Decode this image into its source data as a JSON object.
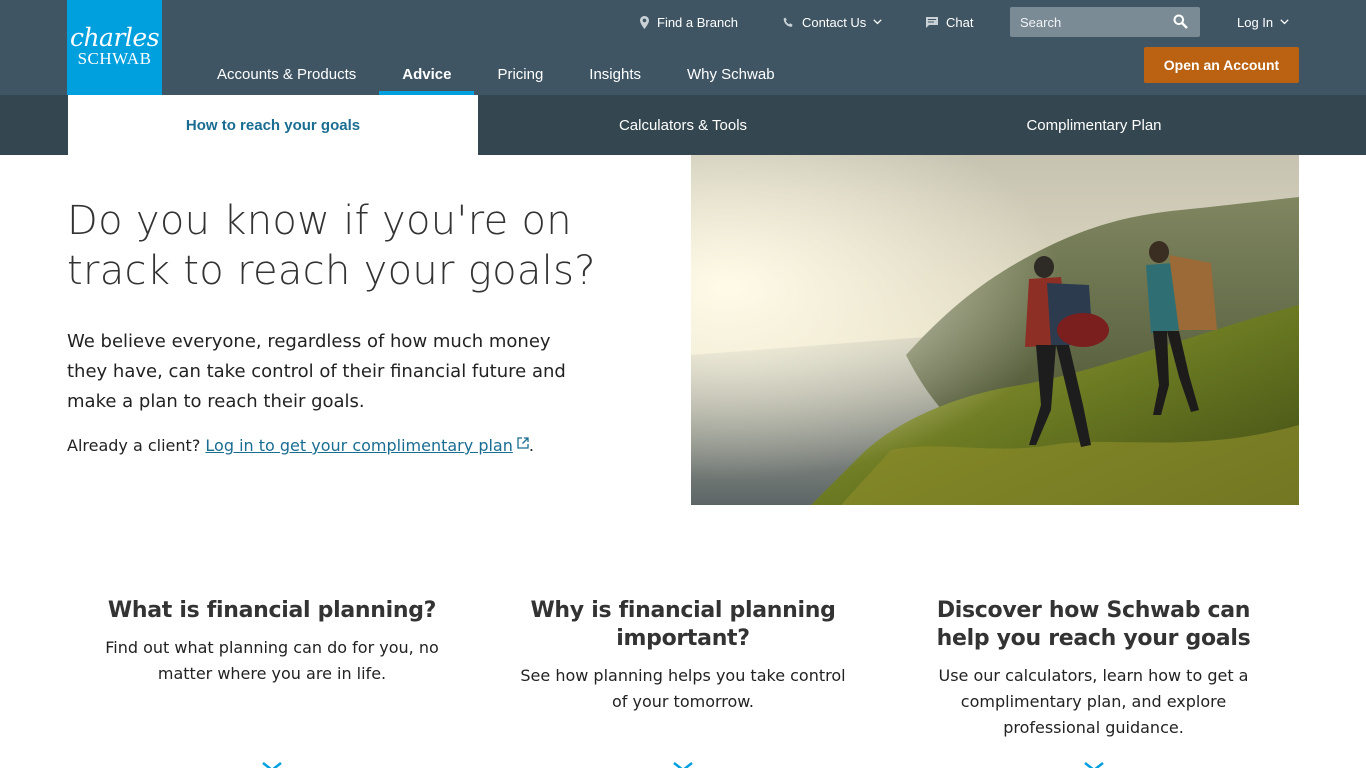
{
  "logo": {
    "line1": "charles",
    "line2": "SCHWAB"
  },
  "utility": {
    "find_branch": "Find a Branch",
    "contact_us": "Contact Us",
    "chat": "Chat",
    "search_placeholder": "Search",
    "login": "Log In"
  },
  "main_nav": [
    {
      "label": "Accounts & Products"
    },
    {
      "label": "Advice",
      "active": true
    },
    {
      "label": "Pricing"
    },
    {
      "label": "Insights"
    },
    {
      "label": "Why Schwab"
    }
  ],
  "open_account": "Open an Account",
  "sub_nav": [
    {
      "label": "How to reach your goals",
      "active": true
    },
    {
      "label": "Calculators & Tools"
    },
    {
      "label": "Complimentary Plan"
    }
  ],
  "hero": {
    "title": "Do you know if you're on track to reach your goals?",
    "description": "We believe everyone, regardless of how much money they have, can take control of their financial future and make a plan to reach their goals.",
    "client_prefix": "Already a client?",
    "client_link": "Log in to get your complimentary plan",
    "client_suffix": ".",
    "image_icon": "hikers-on-coastal-cliff-image"
  },
  "columns": [
    {
      "title": "What is financial planning?",
      "text": "Find out what planning can do for you, no matter where you are in life."
    },
    {
      "title": "Why is financial planning important?",
      "text": "See how planning helps you take control of your tomorrow."
    },
    {
      "title": "Discover how Schwab can help you reach your goals",
      "text": "Use our calculators, learn how to get a complimentary plan, and explore professional guidance."
    }
  ],
  "colors": {
    "header_bg": "#3f5563",
    "subnav_bg": "#34464f",
    "brand_blue": "#00a0df",
    "cta_orange": "#ba6212",
    "link_blue": "#1a6d92"
  }
}
